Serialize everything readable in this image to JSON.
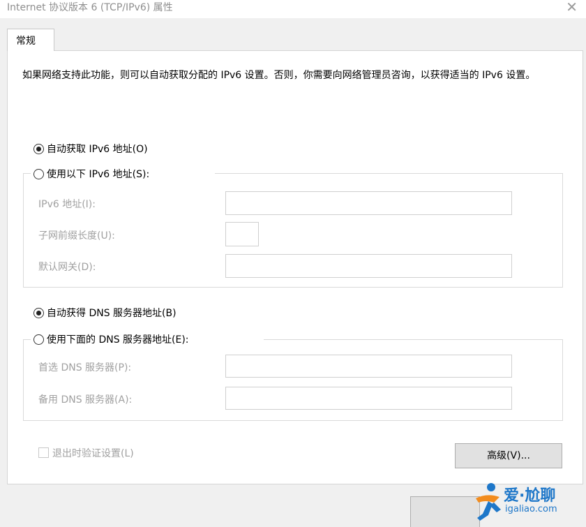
{
  "window": {
    "title": "Internet 协议版本 6 (TCP/IPv6) 属性",
    "close_icon": "close-icon"
  },
  "tab": {
    "label": "常规"
  },
  "description": "如果网络支持此功能，则可以自动获取分配的 IPv6 设置。否则，你需要向网络管理员咨询，以获得适当的 IPv6 设置。",
  "ip_mode": {
    "auto_label": "自动获取 IPv6 地址(O)",
    "manual_label": "使用以下 IPv6 地址(S):",
    "selected": "auto",
    "fields": {
      "ipv6_address_label": "IPv6 地址(I):",
      "ipv6_address_value": "",
      "prefix_length_label": "子网前缀长度(U):",
      "prefix_length_value": "",
      "gateway_label": "默认网关(D):",
      "gateway_value": ""
    }
  },
  "dns_mode": {
    "auto_label": "自动获得 DNS 服务器地址(B)",
    "manual_label": "使用下面的 DNS 服务器地址(E):",
    "selected": "auto",
    "fields": {
      "preferred_label": "首选 DNS 服务器(P):",
      "preferred_value": "",
      "alternate_label": "备用 DNS 服务器(A):",
      "alternate_value": ""
    }
  },
  "validate_checkbox": {
    "label": "退出时验证设置(L)",
    "checked": false
  },
  "buttons": {
    "advanced": "高级(V)..."
  },
  "watermark": {
    "brand": "爱·尬聊",
    "url": "igaliao.com"
  },
  "colors": {
    "watermark_blue": "#1e77c9",
    "watermark_orange": "#f28c1e"
  }
}
